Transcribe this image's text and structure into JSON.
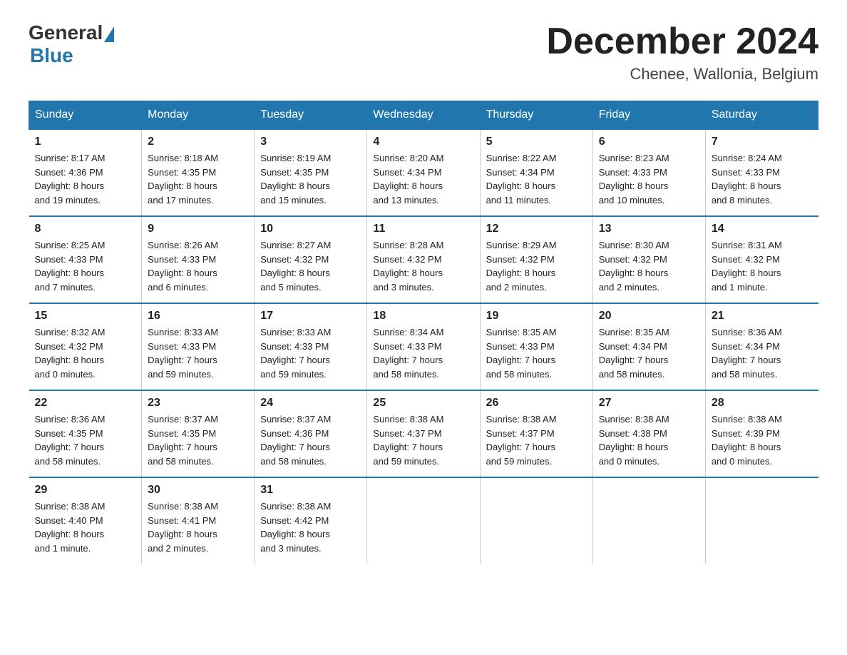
{
  "logo": {
    "general": "General",
    "blue": "Blue"
  },
  "title": "December 2024",
  "location": "Chenee, Wallonia, Belgium",
  "days_of_week": [
    "Sunday",
    "Monday",
    "Tuesday",
    "Wednesday",
    "Thursday",
    "Friday",
    "Saturday"
  ],
  "weeks": [
    [
      {
        "day": "1",
        "sunrise": "8:17 AM",
        "sunset": "4:36 PM",
        "daylight": "8 hours and 19 minutes."
      },
      {
        "day": "2",
        "sunrise": "8:18 AM",
        "sunset": "4:35 PM",
        "daylight": "8 hours and 17 minutes."
      },
      {
        "day": "3",
        "sunrise": "8:19 AM",
        "sunset": "4:35 PM",
        "daylight": "8 hours and 15 minutes."
      },
      {
        "day": "4",
        "sunrise": "8:20 AM",
        "sunset": "4:34 PM",
        "daylight": "8 hours and 13 minutes."
      },
      {
        "day": "5",
        "sunrise": "8:22 AM",
        "sunset": "4:34 PM",
        "daylight": "8 hours and 11 minutes."
      },
      {
        "day": "6",
        "sunrise": "8:23 AM",
        "sunset": "4:33 PM",
        "daylight": "8 hours and 10 minutes."
      },
      {
        "day": "7",
        "sunrise": "8:24 AM",
        "sunset": "4:33 PM",
        "daylight": "8 hours and 8 minutes."
      }
    ],
    [
      {
        "day": "8",
        "sunrise": "8:25 AM",
        "sunset": "4:33 PM",
        "daylight": "8 hours and 7 minutes."
      },
      {
        "day": "9",
        "sunrise": "8:26 AM",
        "sunset": "4:33 PM",
        "daylight": "8 hours and 6 minutes."
      },
      {
        "day": "10",
        "sunrise": "8:27 AM",
        "sunset": "4:32 PM",
        "daylight": "8 hours and 5 minutes."
      },
      {
        "day": "11",
        "sunrise": "8:28 AM",
        "sunset": "4:32 PM",
        "daylight": "8 hours and 3 minutes."
      },
      {
        "day": "12",
        "sunrise": "8:29 AM",
        "sunset": "4:32 PM",
        "daylight": "8 hours and 2 minutes."
      },
      {
        "day": "13",
        "sunrise": "8:30 AM",
        "sunset": "4:32 PM",
        "daylight": "8 hours and 2 minutes."
      },
      {
        "day": "14",
        "sunrise": "8:31 AM",
        "sunset": "4:32 PM",
        "daylight": "8 hours and 1 minute."
      }
    ],
    [
      {
        "day": "15",
        "sunrise": "8:32 AM",
        "sunset": "4:32 PM",
        "daylight": "8 hours and 0 minutes."
      },
      {
        "day": "16",
        "sunrise": "8:33 AM",
        "sunset": "4:33 PM",
        "daylight": "7 hours and 59 minutes."
      },
      {
        "day": "17",
        "sunrise": "8:33 AM",
        "sunset": "4:33 PM",
        "daylight": "7 hours and 59 minutes."
      },
      {
        "day": "18",
        "sunrise": "8:34 AM",
        "sunset": "4:33 PM",
        "daylight": "7 hours and 58 minutes."
      },
      {
        "day": "19",
        "sunrise": "8:35 AM",
        "sunset": "4:33 PM",
        "daylight": "7 hours and 58 minutes."
      },
      {
        "day": "20",
        "sunrise": "8:35 AM",
        "sunset": "4:34 PM",
        "daylight": "7 hours and 58 minutes."
      },
      {
        "day": "21",
        "sunrise": "8:36 AM",
        "sunset": "4:34 PM",
        "daylight": "7 hours and 58 minutes."
      }
    ],
    [
      {
        "day": "22",
        "sunrise": "8:36 AM",
        "sunset": "4:35 PM",
        "daylight": "7 hours and 58 minutes."
      },
      {
        "day": "23",
        "sunrise": "8:37 AM",
        "sunset": "4:35 PM",
        "daylight": "7 hours and 58 minutes."
      },
      {
        "day": "24",
        "sunrise": "8:37 AM",
        "sunset": "4:36 PM",
        "daylight": "7 hours and 58 minutes."
      },
      {
        "day": "25",
        "sunrise": "8:38 AM",
        "sunset": "4:37 PM",
        "daylight": "7 hours and 59 minutes."
      },
      {
        "day": "26",
        "sunrise": "8:38 AM",
        "sunset": "4:37 PM",
        "daylight": "7 hours and 59 minutes."
      },
      {
        "day": "27",
        "sunrise": "8:38 AM",
        "sunset": "4:38 PM",
        "daylight": "8 hours and 0 minutes."
      },
      {
        "day": "28",
        "sunrise": "8:38 AM",
        "sunset": "4:39 PM",
        "daylight": "8 hours and 0 minutes."
      }
    ],
    [
      {
        "day": "29",
        "sunrise": "8:38 AM",
        "sunset": "4:40 PM",
        "daylight": "8 hours and 1 minute."
      },
      {
        "day": "30",
        "sunrise": "8:38 AM",
        "sunset": "4:41 PM",
        "daylight": "8 hours and 2 minutes."
      },
      {
        "day": "31",
        "sunrise": "8:38 AM",
        "sunset": "4:42 PM",
        "daylight": "8 hours and 3 minutes."
      },
      null,
      null,
      null,
      null
    ]
  ],
  "labels": {
    "sunrise": "Sunrise:",
    "sunset": "Sunset:",
    "daylight": "Daylight:"
  }
}
